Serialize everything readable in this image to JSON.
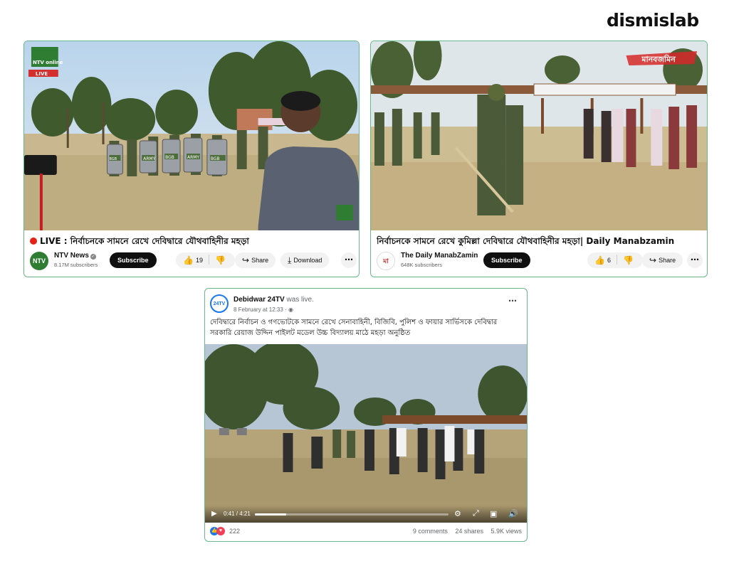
{
  "brand": "dismislab",
  "card1": {
    "watermark": "NTV online",
    "live_badge": "LIVE",
    "video_soldier_shield_labels": [
      "BGB",
      "ARMY",
      "BGB",
      "ARMY",
      "BGB"
    ],
    "title": "LIVE : নির্বাচনকে সামনে রেখে দেবিদ্বারে যৌথবাহিনীর মহড়া",
    "channel": "NTV News",
    "subscribers": "8.17M subscribers",
    "subscribe": "Subscribe",
    "likes": "19",
    "share": "Share",
    "download": "Download"
  },
  "card2": {
    "watermark": "মানবজমিন",
    "title": "নির্বাচনকে সামনে রেখে কুমিল্লা দেবিদ্বারে যৌথবাহিনীর মহড়া| Daily Manabzamin",
    "channel": "The Daily ManabZamin",
    "subscribers": "648K subscribers",
    "subscribe": "Subscribe",
    "likes": "6",
    "share": "Share"
  },
  "card3": {
    "page_name": "Debidwar 24TV",
    "status": "was live.",
    "time": "8 February at 12:33 · ",
    "text": "দেবিদ্বারে নির্বাচন ও গণভোটকে সামনে রেখে সেনাবাহিনী, বিজিবি, পুলিশ ও ফায়ার সার্ভিসকে  দেবিদ্বার সরকারি রেয়াজ উদ্দিন পাইলট মডেল উচ্চ বিদ্যালয় মাঠে মহড়া অনুষ্ঠিত",
    "video_time": "0:41 / 4:21",
    "progress": 0.16,
    "reactions": "222",
    "comments": "9 comments",
    "shares": "24 shares",
    "views": "5.9K views"
  },
  "colors": {
    "card_border": "#67b88a",
    "youtube_red": "#e62117",
    "facebook_blue": "#1877f2",
    "love_red": "#f33e58"
  },
  "icons": [
    "like-icon",
    "dislike-icon",
    "share-icon",
    "download-icon",
    "more-icon",
    "globe-icon",
    "play-icon",
    "settings-icon",
    "fullscreen-icon",
    "pip-icon",
    "volume-icon"
  ]
}
